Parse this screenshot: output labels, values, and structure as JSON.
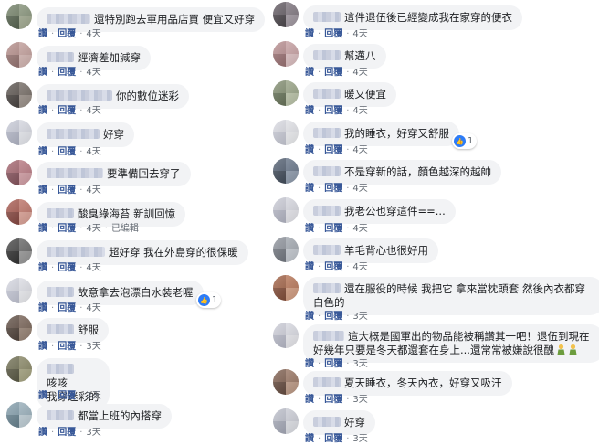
{
  "actions": {
    "reply_label": "回覆",
    "dot": "·"
  },
  "left": [
    {
      "text": "還特別跑去軍用品店買 便宜又好穿",
      "name_w": 48,
      "time": "4天",
      "edited": "",
      "reaction": "",
      "avatar": [
        "#6f7d63",
        "#8d9a80",
        "#4c5a45",
        "#a5ae94"
      ]
    },
    {
      "text": "經濟差加減穿",
      "name_w": 30,
      "time": "4天",
      "edited": "",
      "reaction": "",
      "avatar": [
        "#b28a86",
        "#c9a5a1",
        "#8f6b68",
        "#d8b9b5"
      ]
    },
    {
      "text": "你的數位迷彩",
      "name_w": 72,
      "time": "4天",
      "edited": "",
      "reaction": "",
      "avatar": [
        "#57504b",
        "#7a716a",
        "#3c3633",
        "#9c928a"
      ]
    },
    {
      "text": "好穿",
      "name_w": 58,
      "time": "4天",
      "edited": "",
      "reaction": "",
      "avatar": [
        "#c6c9d6",
        "#dfe1ea",
        "#aeb2c3",
        "#eceef4"
      ]
    },
    {
      "text": "要準備回去穿了",
      "name_w": 62,
      "time": "4天",
      "edited": "",
      "reaction": "",
      "avatar": [
        "#a0606a",
        "#c07f88",
        "#7d4751",
        "#d7a1a8"
      ]
    },
    {
      "text": "酸臭綠海苔 新訓回憶",
      "name_w": 30,
      "time": "4天",
      "edited": "已編輯",
      "reaction": "",
      "avatar": [
        "#a3544a",
        "#c57a6e",
        "#7e3b34",
        "#e0a498"
      ]
    },
    {
      "text": "超好穿 我在外島穿的很保暖",
      "name_w": 64,
      "time": "4天",
      "edited": "",
      "reaction": "",
      "avatar": [
        "#3f3f3f",
        "#6d6d6d",
        "#242424",
        "#9a9a9a"
      ]
    },
    {
      "text": "故意拿去泡漂白水裝老喔",
      "name_w": 30,
      "time": "4天",
      "edited": "",
      "reaction": "1",
      "avatar": [
        "#d3d5df",
        "#e6e7ee",
        "#bfc2d1",
        "#f1f2f6"
      ]
    },
    {
      "text": "舒服",
      "name_w": 30,
      "time": "3天",
      "edited": "",
      "reaction": "",
      "avatar": [
        "#5c4a3f",
        "#7d685b",
        "#44362d",
        "#9a8576"
      ]
    },
    {
      "text": "咳咳\n我穿迷彩的",
      "name_w": 30,
      "time": "3天",
      "edited": "",
      "reaction": "",
      "avatar": [
        "#6b6a4d",
        "#8e8c6a",
        "#4e4d37",
        "#a9a783"
      ]
    },
    {
      "text": "都當上班的內搭穿",
      "name_w": 30,
      "time": "3天",
      "edited": "",
      "reaction": "",
      "avatar": [
        "#7f9aa8",
        "#9fb6c2",
        "#5e7a88",
        "#c3d3db"
      ]
    }
  ],
  "right": [
    {
      "text": "這件退伍後已經變成我在家穿的便衣",
      "name_w": 30,
      "time": "4天",
      "edited": "",
      "reaction": "",
      "avatar": [
        "#5e565e",
        "#857c85",
        "#403a40",
        "#a59ca5"
      ]
    },
    {
      "text": "幫邁八",
      "name_w": 30,
      "time": "4天",
      "edited": "",
      "reaction": "",
      "avatar": [
        "#b58a8c",
        "#cfa8aa",
        "#93686a",
        "#e2c4c6"
      ]
    },
    {
      "text": "暖又便宜",
      "name_w": 30,
      "time": "4天",
      "edited": "",
      "reaction": "",
      "avatar": [
        "#7e8a6c",
        "#a0ab8d",
        "#5d6a4e",
        "#c0c9ad"
      ]
    },
    {
      "text": "我的睡衣，好穿又舒服",
      "name_w": 30,
      "time": "4天",
      "edited": "",
      "reaction": "1",
      "avatar": [
        "#d8d9e1",
        "#eaebf0",
        "#c4c6d2",
        "#f3f4f7"
      ]
    },
    {
      "text": "不是穿新的話，顏色越深的越帥",
      "name_w": 30,
      "time": "4天",
      "edited": "",
      "reaction": "",
      "avatar": [
        "#4d5a6d",
        "#6e7c90",
        "#35404f",
        "#929fb1"
      ]
    },
    {
      "text": "我老公也穿這件==...",
      "name_w": 30,
      "time": "4天",
      "edited": "",
      "reaction": "",
      "avatar": [
        "#c7c8d3",
        "#dfe0e8",
        "#b0b2c1",
        "#ececf2"
      ]
    },
    {
      "text": "羊毛背心也很好用",
      "name_w": 30,
      "time": "4天",
      "edited": "",
      "reaction": "",
      "avatar": [
        "#8a8f98",
        "#aab0b8",
        "#6a6f78",
        "#c9ced5"
      ]
    },
    {
      "text": "還在服役的時候 我把它 拿來當枕頭套 然後內衣都穿白色的",
      "name_w": 30,
      "time": "3天",
      "edited": "",
      "reaction": "",
      "avatar": [
        "#9d5c3f",
        "#bf7c5d",
        "#7a412b",
        "#d8a083"
      ]
    },
    {
      "text": "這大概是國軍出的物品能被稱讚其一吧！退伍到現在好幾年只要是冬天都還套在身上...還常常被嫌說很醜",
      "name_w": 34,
      "time": "3天",
      "edited": "",
      "reaction": "",
      "emoji": "2",
      "avatar": [
        "#cacbd6",
        "#e1e2ea",
        "#b3b5c4",
        "#eeeef3"
      ]
    },
    {
      "text": "夏天睡衣，冬天內衣，好穿又吸汗",
      "name_w": 30,
      "time": "3天",
      "edited": "",
      "reaction": "",
      "avatar": [
        "#7b5a4a",
        "#a07c69",
        "#5b4033",
        "#c29e89"
      ]
    },
    {
      "text": "好穿",
      "name_w": 30,
      "time": "3天",
      "edited": "",
      "reaction": "",
      "avatar": [
        "#b9bcc8",
        "#d3d5de",
        "#a0a4b3",
        "#e4e6ec"
      ]
    }
  ]
}
